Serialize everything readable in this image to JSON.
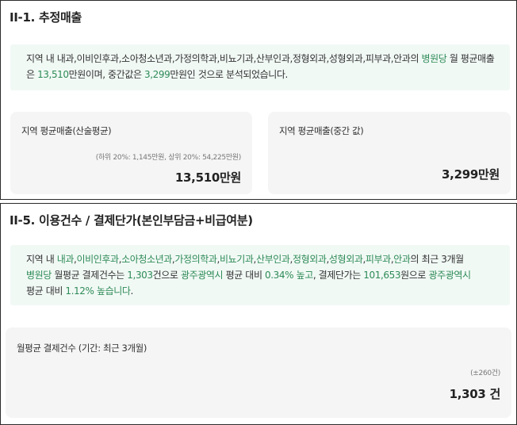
{
  "section1": {
    "title": "II-1. 추정매출",
    "note": {
      "p1": "지역 내 내과,이비인후과,소아청소년과,가정의학과,비뇨기과,산부인과,정형외과,성형외과,피부과,안과의 ",
      "type": "병원당",
      "p2": " 월 평균매출은 ",
      "avg": "13,510",
      "p3": "만원이며, 중간값은 ",
      "median": "3,299",
      "p4": "만원인 것으로 분석되었습니다."
    },
    "card_mean": {
      "label": "지역 평균매출(산술평균)",
      "sub": "(하위 20%: 1,145만원, 상위 20%: 54,225만원)",
      "value": "13,510만원"
    },
    "card_median": {
      "label": "지역 평균매출(중간 값)",
      "value": "3,299만원"
    }
  },
  "section2": {
    "title": "II-5. 이용건수 / 결제단가(본인부담금+비급여분)",
    "note": {
      "p1": "지역 내 ",
      "specialties": [
        "내과",
        "이비인후과",
        "소아청소년과",
        "가정의학과",
        "비뇨기과",
        "산부인과",
        "정형외과",
        "성형외과",
        "피부과",
        "안과"
      ],
      "sep": ",",
      "p2": "의 최근 3개월",
      "type": "병원당",
      "p3": " 월평균 결제건수는 ",
      "count": "1,303",
      "p4": "건으로 ",
      "region1": "광주광역시",
      "p5": " 평균 대비 ",
      "count_diff": "0.34% 높고",
      "p6": ", 결제단가는 ",
      "price": "101,653",
      "p7": "원으로 ",
      "region2": "광주광역시",
      "p8": "평균 대비 ",
      "price_diff": "1.12% 높습니다",
      "p9": "."
    },
    "card_count": {
      "label": "월평균 결제건수 (기간: 최근 3개월)",
      "sub": "(±260건)",
      "value": "1,303 건"
    }
  },
  "colors": {
    "accent_green": "#2e8b57",
    "note_bg": "#f1f9f5",
    "card_bg": "#f5f5f5"
  }
}
